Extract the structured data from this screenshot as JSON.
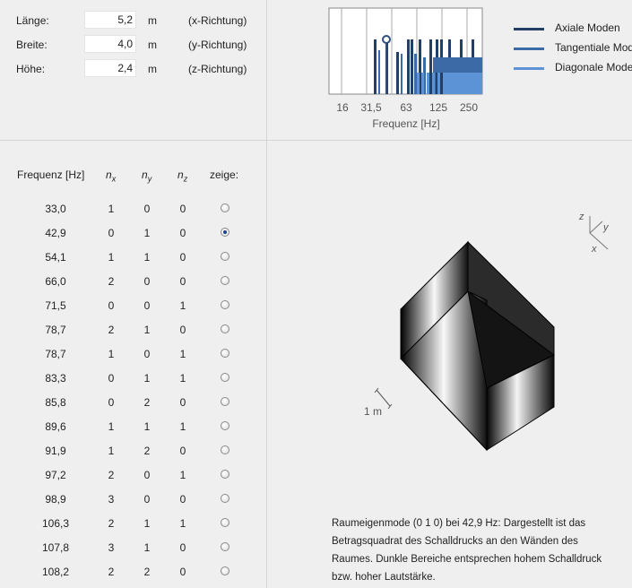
{
  "dimensions": [
    {
      "label": "Länge:",
      "value": "5,2",
      "unit": "m",
      "direction": "(x-Richtung)"
    },
    {
      "label": "Breite:",
      "value": "4,0",
      "unit": "m",
      "direction": "(y-Richtung)"
    },
    {
      "label": "Höhe:",
      "value": "2,4",
      "unit": "m",
      "direction": "(z-Richtung)"
    }
  ],
  "spectrum": {
    "tick_labels": [
      "16",
      "31,5",
      "63",
      "125",
      "250"
    ],
    "xlabel": "Frequenz [Hz]"
  },
  "legend": [
    {
      "label": "Axiale Moden",
      "color": "#243f66"
    },
    {
      "label": "Tangentiale Moden",
      "color": "#3c6aa6"
    },
    {
      "label": "Diagonale Moden",
      "color": "#5b93d6"
    }
  ],
  "table": {
    "headers": {
      "freq": "Frequenz [Hz]",
      "nx": "n",
      "nx_sub": "x",
      "ny": "n",
      "ny_sub": "y",
      "nz": "n",
      "nz_sub": "z",
      "show": "zeige:"
    },
    "rows": [
      {
        "freq": "33,0",
        "nx": "1",
        "ny": "0",
        "nz": "0",
        "selected": false
      },
      {
        "freq": "42,9",
        "nx": "0",
        "ny": "1",
        "nz": "0",
        "selected": true
      },
      {
        "freq": "54,1",
        "nx": "1",
        "ny": "1",
        "nz": "0",
        "selected": false
      },
      {
        "freq": "66,0",
        "nx": "2",
        "ny": "0",
        "nz": "0",
        "selected": false
      },
      {
        "freq": "71,5",
        "nx": "0",
        "ny": "0",
        "nz": "1",
        "selected": false
      },
      {
        "freq": "78,7",
        "nx": "2",
        "ny": "1",
        "nz": "0",
        "selected": false
      },
      {
        "freq": "78,7",
        "nx": "1",
        "ny": "0",
        "nz": "1",
        "selected": false
      },
      {
        "freq": "83,3",
        "nx": "0",
        "ny": "1",
        "nz": "1",
        "selected": false
      },
      {
        "freq": "85,8",
        "nx": "0",
        "ny": "2",
        "nz": "0",
        "selected": false
      },
      {
        "freq": "89,6",
        "nx": "1",
        "ny": "1",
        "nz": "1",
        "selected": false
      },
      {
        "freq": "91,9",
        "nx": "1",
        "ny": "2",
        "nz": "0",
        "selected": false
      },
      {
        "freq": "97,2",
        "nx": "2",
        "ny": "0",
        "nz": "1",
        "selected": false
      },
      {
        "freq": "98,9",
        "nx": "3",
        "ny": "0",
        "nz": "0",
        "selected": false
      },
      {
        "freq": "106,3",
        "nx": "2",
        "ny": "1",
        "nz": "1",
        "selected": false
      },
      {
        "freq": "107,8",
        "nx": "3",
        "ny": "1",
        "nz": "0",
        "selected": false
      },
      {
        "freq": "108,2",
        "nx": "2",
        "ny": "2",
        "nz": "0",
        "selected": false
      }
    ]
  },
  "view3d": {
    "axis_z": "z",
    "axis_y": "y",
    "axis_x": "x",
    "scale_label": "1 m"
  },
  "description": "Raumeigenmode (0 1 0) bei 42,9 Hz: Dargestellt ist das Betragsquadrat des Schalldrucks an den Wänden des Raumes. Dunkle Bereiche entsprechen hohem Schalldruck bzw. hoher Lautstärke."
}
